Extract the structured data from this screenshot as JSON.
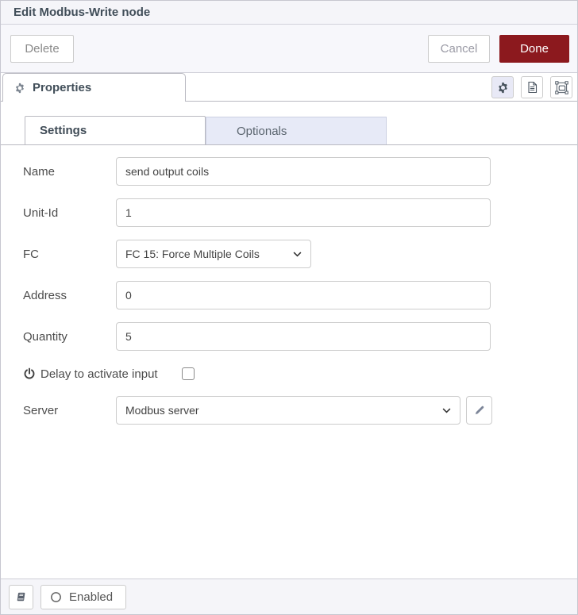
{
  "header": {
    "title": "Edit Modbus-Write node"
  },
  "toolbar": {
    "delete_label": "Delete",
    "cancel_label": "Cancel",
    "done_label": "Done"
  },
  "editor_tabs": {
    "properties_label": "Properties"
  },
  "subtabs": {
    "settings_label": "Settings",
    "optionals_label": "Optionals"
  },
  "form": {
    "name": {
      "label": "Name",
      "value": "send output coils"
    },
    "unit_id": {
      "label": "Unit-Id",
      "value": "1"
    },
    "fc": {
      "label": "FC",
      "value": "FC 15: Force Multiple Coils"
    },
    "address": {
      "label": "Address",
      "value": "0"
    },
    "quantity": {
      "label": "Quantity",
      "value": "5"
    },
    "delay": {
      "label": "Delay to activate input",
      "checked": false
    },
    "server": {
      "label": "Server",
      "value": "Modbus server"
    }
  },
  "footer": {
    "enabled_label": "Enabled"
  },
  "icons": {
    "properties_tab": "gear-icon",
    "editor_buttons": [
      "gear-icon",
      "document-icon",
      "appearance-icon"
    ],
    "delay_row": "power-icon",
    "server_edit": "pencil-icon",
    "footer": [
      "book-icon",
      "circle-icon"
    ],
    "selects": "chevron-down-icon"
  },
  "colors": {
    "done_button_bg": "#8C191E",
    "chrome_bg": "#f5f5f9",
    "inactive_tab_bg": "#e7eaf7",
    "active_icon_button_bg": "#e8e9f6"
  }
}
